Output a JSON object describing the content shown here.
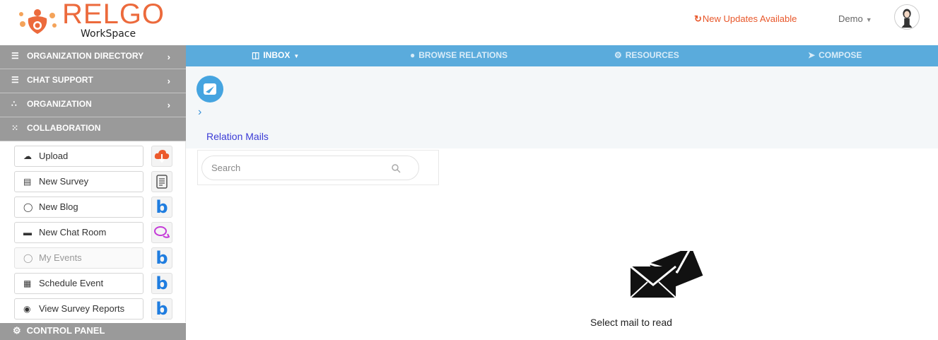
{
  "app": {
    "logo_text": "RELGO",
    "logo_sub": "WorkSpace",
    "brand_color": "#ec6a3c",
    "accent_color": "#5aabdc"
  },
  "header": {
    "updates_label": "New Updates Available",
    "updates_icon": "refresh-icon",
    "user_label": "Demo",
    "avatar_icon": "user-avatar-icon"
  },
  "sidebar": {
    "sections": [
      {
        "label": "ORGANIZATION DIRECTORY",
        "icon": "list-icon"
      },
      {
        "label": "CHAT SUPPORT",
        "icon": "list-icon"
      },
      {
        "label": "ORGANIZATION",
        "icon": "sitemap-icon"
      },
      {
        "label": "COLLABORATION",
        "icon": "users-icon"
      }
    ],
    "items": [
      {
        "label": "Upload",
        "icon": "cloud-upload-icon",
        "tile": "cloud-download-icon"
      },
      {
        "label": "New Survey",
        "icon": "survey-icon",
        "tile": "document-icon"
      },
      {
        "label": "New Blog",
        "icon": "comment-icon",
        "tile": "blog-icon"
      },
      {
        "label": "New Chat Room",
        "icon": "chat-icon",
        "tile": "chat-bubbles-icon"
      },
      {
        "label": "My Events",
        "icon": "comment-icon",
        "tile": "blog-icon"
      },
      {
        "label": "Schedule Event",
        "icon": "calendar-icon",
        "tile": "blog-icon"
      },
      {
        "label": "View Survey Reports",
        "icon": "eye-icon",
        "tile": "blog-icon"
      }
    ],
    "control_panel": "CONTROL PANEL"
  },
  "nav": {
    "inbox": "INBOX",
    "browse": "BROWSE RELATIONS",
    "resources": "RESOURCES",
    "compose": "COMPOSE"
  },
  "main": {
    "section_title": "Relation Mails",
    "search_placeholder": "Search",
    "empty_message": "Select mail to read"
  }
}
